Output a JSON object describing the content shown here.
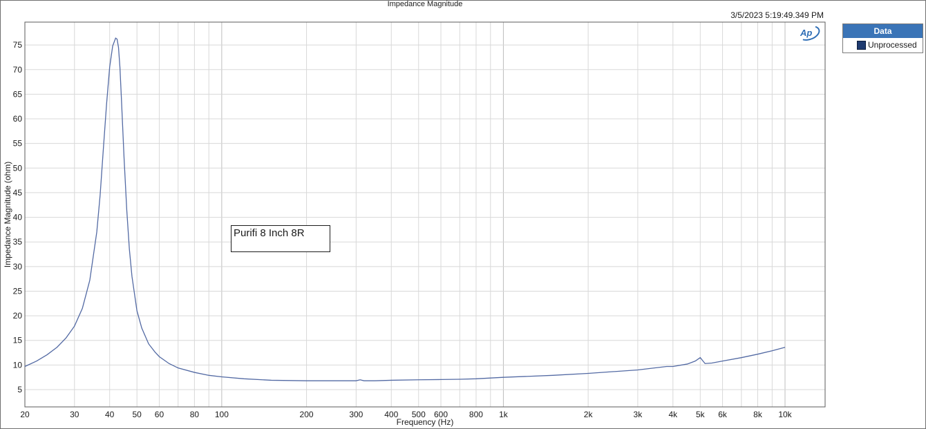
{
  "header": {
    "title": "Impedance Magnitude",
    "timestamp": "3/5/2023 5:19:49.349 PM",
    "logo_text": "Ap"
  },
  "legend": {
    "title": "Data",
    "items": [
      {
        "label": "Unprocessed",
        "color": "#1f3b70"
      }
    ]
  },
  "annotation": {
    "text": "Purifi 8 Inch 8R"
  },
  "colors": {
    "line": "#5269a3",
    "grid": "#d8d8d8",
    "legend_header": "#3a74b7"
  },
  "chart_data": {
    "type": "line",
    "title": "Impedance Magnitude",
    "xlabel": "Frequency (Hz)",
    "ylabel": "Impedance Magnitude (ohm)",
    "x_scale": "log",
    "xlim": [
      20,
      20000
    ],
    "ylim": [
      1,
      80
    ],
    "grid": true,
    "legend_position": "outside-right",
    "x_tick_values": [
      20,
      30,
      40,
      50,
      60,
      80,
      100,
      200,
      300,
      400,
      500,
      600,
      800,
      1000,
      2000,
      3000,
      4000,
      5000,
      6000,
      8000,
      10000
    ],
    "x_tick_labels": [
      "20",
      "30",
      "40",
      "50",
      "60",
      "80",
      "100",
      "200",
      "300",
      "400",
      "500",
      "600",
      "800",
      "1k",
      "2k",
      "3k",
      "4k",
      "5k",
      "6k",
      "8k",
      "10k"
    ],
    "y_tick_values": [
      5,
      10,
      15,
      20,
      25,
      30,
      35,
      40,
      45,
      50,
      55,
      60,
      65,
      70,
      75
    ],
    "y_tick_labels": [
      "5",
      "10",
      "15",
      "20",
      "25",
      "30",
      "35",
      "40",
      "45",
      "50",
      "55",
      "60",
      "65",
      "70",
      "75"
    ],
    "series": [
      {
        "name": "Unprocessed",
        "x": [
          20,
          22,
          24,
          26,
          28,
          30,
          32,
          34,
          36,
          37,
          38,
          39,
          40,
          41,
          42,
          42.5,
          43,
          43.5,
          44,
          45,
          46,
          47,
          48,
          50,
          52,
          55,
          58,
          60,
          65,
          70,
          80,
          90,
          100,
          120,
          150,
          200,
          250,
          300,
          310,
          320,
          350,
          400,
          500,
          600,
          700,
          800,
          1000,
          1500,
          2000,
          3000,
          3800,
          4000,
          4500,
          4800,
          5000,
          5200,
          5500,
          6000,
          7000,
          8000,
          9000,
          10000
        ],
        "y": [
          9.7,
          10.8,
          12.1,
          13.6,
          15.5,
          17.9,
          21.5,
          27.2,
          37.0,
          44.5,
          54.0,
          63.0,
          70.5,
          74.8,
          76.4,
          76.2,
          74.5,
          70.5,
          64.5,
          52.0,
          41.5,
          33.5,
          28.0,
          21.0,
          17.5,
          14.3,
          12.6,
          11.7,
          10.3,
          9.4,
          8.5,
          7.9,
          7.6,
          7.2,
          6.9,
          6.8,
          6.8,
          6.8,
          7.0,
          6.8,
          6.8,
          6.9,
          7.0,
          7.05,
          7.1,
          7.2,
          7.5,
          7.9,
          8.3,
          9.0,
          9.7,
          9.7,
          10.2,
          10.8,
          11.5,
          10.3,
          10.4,
          10.8,
          11.5,
          12.2,
          12.9,
          13.6
        ]
      }
    ]
  }
}
